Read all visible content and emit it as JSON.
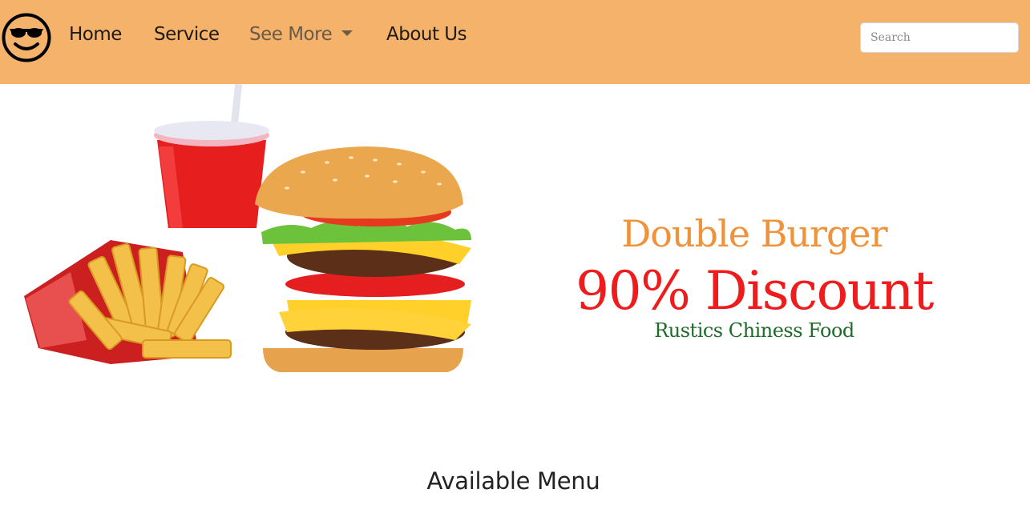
{
  "nav": {
    "logo_icon": "sunglasses-smiley-icon",
    "items": [
      {
        "label": "Home"
      },
      {
        "label": "Service"
      },
      {
        "label": "See More"
      },
      {
        "label": "About Us"
      }
    ],
    "search_placeholder": "Search"
  },
  "hero": {
    "image_icon": "burger-fries-drink-image",
    "title": "Double Burger",
    "discount": "90% Discount",
    "subtitle": "Rustics Chiness Food"
  },
  "section": {
    "title": "Available Menu"
  },
  "colors": {
    "navbar": "#f5b26b",
    "title": "#f0923a",
    "discount": "#ee1c1c",
    "subtitle": "#1f6b2a"
  }
}
